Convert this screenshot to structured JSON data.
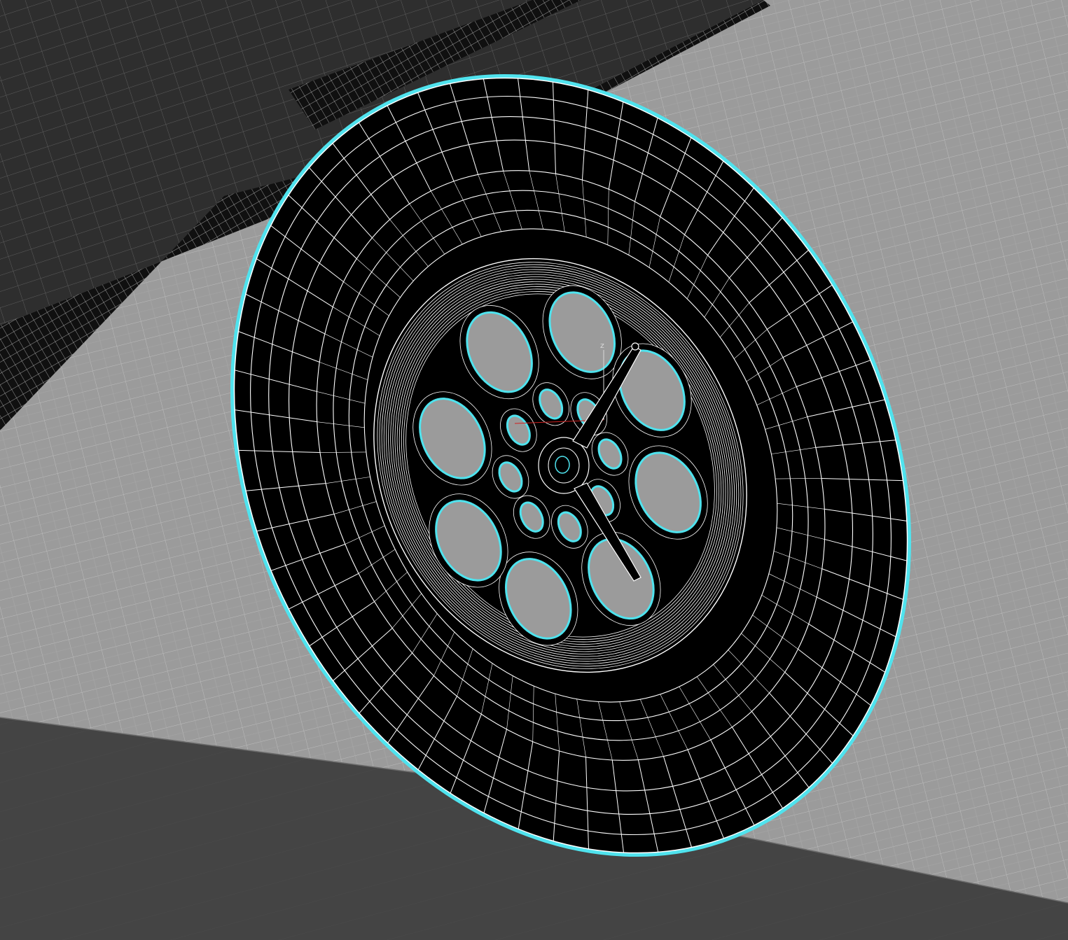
{
  "viewport": {
    "mode": "wireframe",
    "view": "perspective",
    "colors": {
      "floor_light": "#9b9b9b",
      "floor_dark": "#464646",
      "body_dark": "#2f2f2f",
      "wire": "#ffffff",
      "selection": "#4fe3ee",
      "grid_line": "#b9b9b9",
      "object_fill": "#000000"
    },
    "gizmo": {
      "axis_label": "z",
      "icon": "transform-gizmo-icon"
    },
    "selected_object": {
      "type": "tire-with-rim",
      "tread_segments": 60,
      "rim_large_holes": 8,
      "rim_small_holes": 8
    }
  }
}
